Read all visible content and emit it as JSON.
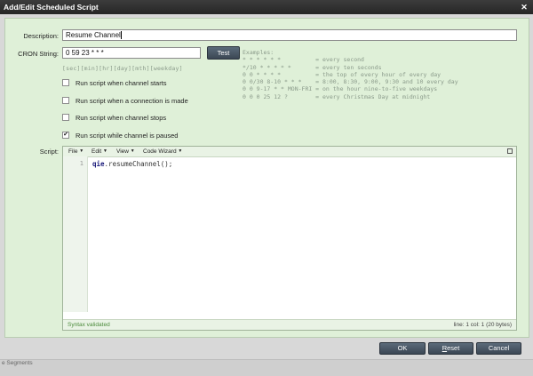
{
  "window": {
    "title": "Add/Edit Scheduled Script"
  },
  "form": {
    "description_label": "Description:",
    "description_value": "Resume Channel",
    "cron_label": "CRON String:",
    "cron_value": "0 59 23 * * *",
    "test_label": "Test",
    "cron_hint": "[sec][min][hr][day][mth][weekday]",
    "examples_title": "Examples:",
    "examples": [
      "* * * * * *          = every second",
      "*/10 * * * * *       = every ten seconds",
      "0 0 * * * *          = the top of every hour of every day",
      "0 0/30 8-10 * * *    = 8:00, 8:30, 9:00, 9:30 and 10 every day",
      "0 0 9-17 * * MON-FRI = on the hour nine-to-five weekdays",
      "0 0 0 25 12 ?        = every Christmas Day at midnight"
    ],
    "checkboxes": [
      {
        "label": "Run script when channel starts",
        "checked": false
      },
      {
        "label": "Run script when a connection is made",
        "checked": false
      },
      {
        "label": "Run script when channel stops",
        "checked": false
      },
      {
        "label": "Run script while channel is paused",
        "checked": true
      }
    ],
    "script_label": "Script:"
  },
  "editor": {
    "menus": [
      "File",
      "Edit",
      "View",
      "Code Wizard"
    ],
    "line_number": "1",
    "code_object": "qie",
    "code_rest": ".resumeChannel();",
    "status_left": "Syntax validated",
    "status_right": "line: 1  col: 1  (20 bytes)"
  },
  "footer": {
    "ok_label": "OK",
    "reset_first": "R",
    "reset_rest": "eset",
    "cancel_label": "Cancel"
  },
  "background": {
    "text": "e Segments"
  }
}
